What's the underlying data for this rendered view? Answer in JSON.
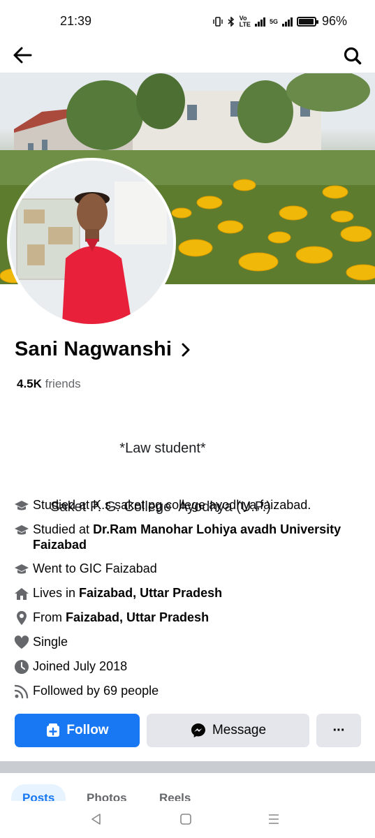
{
  "status_bar": {
    "time": "21:39",
    "battery_percent": "96%",
    "battery_level": 0.96,
    "network_label": "5G"
  },
  "nav": {
    "back_icon": "arrow-left-icon",
    "search_icon": "search-icon"
  },
  "profile": {
    "name": "Sani Nagwanshi",
    "friends_count": "4.5K",
    "friends_label": "friends",
    "bio_line1": "*Law student*",
    "bio_line2": "Saket P. G. College  Ayodhya (U.P.)"
  },
  "details": [
    {
      "icon": "graduation-cap-icon",
      "prefix": "Studied at K.s saket pg college ayodhya,faizabad.",
      "bold": ""
    },
    {
      "icon": "graduation-cap-icon",
      "prefix": "Studied at ",
      "bold": "Dr.Ram Manohar Lohiya avadh University Faizabad"
    },
    {
      "icon": "graduation-cap-icon",
      "prefix": "Went to GIC Faizabad",
      "bold": ""
    },
    {
      "icon": "home-icon",
      "prefix": "Lives in ",
      "bold": "Faizabad, Uttar Pradesh"
    },
    {
      "icon": "location-pin-icon",
      "prefix": "From ",
      "bold": "Faizabad, Uttar Pradesh"
    },
    {
      "icon": "heart-icon",
      "prefix": "Single",
      "bold": ""
    },
    {
      "icon": "clock-icon",
      "prefix": "Joined July 2018",
      "bold": ""
    },
    {
      "icon": "rss-icon",
      "prefix": "Followed by 69 people",
      "bold": ""
    }
  ],
  "actions": {
    "follow_label": "Follow",
    "message_label": "Message",
    "more_label": "···"
  },
  "tabs": [
    {
      "label": "Posts",
      "active": true
    },
    {
      "label": "Photos",
      "active": false
    },
    {
      "label": "Reels",
      "active": false
    }
  ],
  "colors": {
    "brand": "#1877f2",
    "secondary_button": "#e4e6eb",
    "muted_text": "#65676b"
  }
}
